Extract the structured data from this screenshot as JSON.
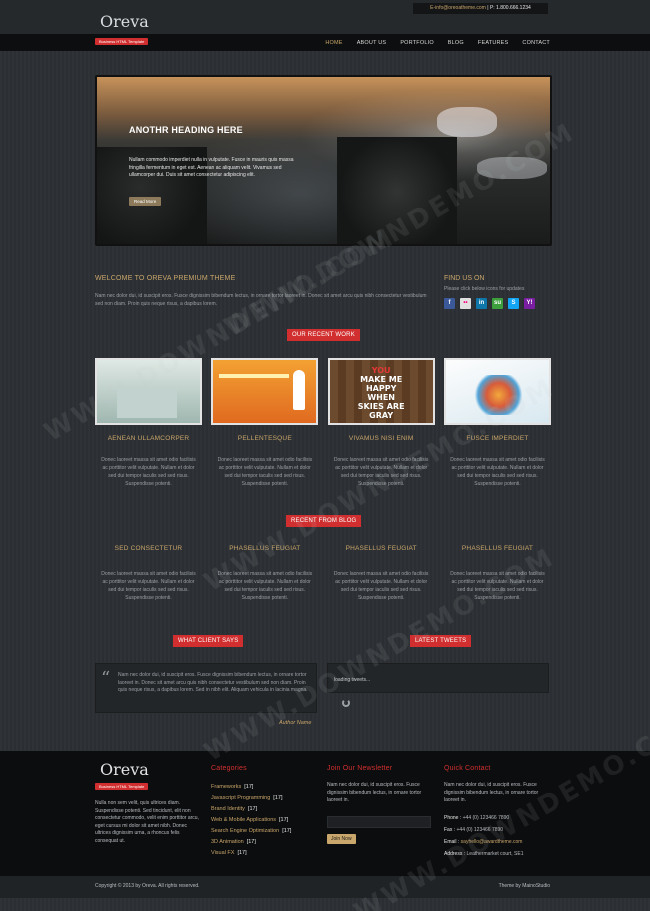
{
  "header": {
    "email": "E-info@oreoatheme.com",
    "phone_label": "P: 1.800.666.1234",
    "logo": "Oreva",
    "tag": "Business HTML Template"
  },
  "nav": {
    "items": [
      {
        "label": "HOME",
        "active": true
      },
      {
        "label": "ABOUT US",
        "active": false
      },
      {
        "label": "PORTFOLIO",
        "active": false
      },
      {
        "label": "BLOG",
        "active": false
      },
      {
        "label": "FEATURES",
        "active": false
      },
      {
        "label": "CONTACT",
        "active": false
      }
    ]
  },
  "slider": {
    "heading": "ANOTHR HEADING HERE",
    "text": "Nullam commodo imperdiet nulla in vulputate. Fusce in mauris quis massa fringilla fermentum in eget est. Aenean ac aliquam velit. Vivamus sed ullamcorper dui. Duis sit amet consectetur adipiscing elit.",
    "button": "Read More"
  },
  "welcome": {
    "title": "WELCOME TO OREVA PREMIUM THEME",
    "text": "Nam nec dolor dui, id suscipit eros. Fusce dignissim bibendum lectus, in ornare tortor laoreet in. Donec sit amet arcu quis nibh consectetur vestibulum sed non diam. Proin quis neque risus, a dapibus lorem."
  },
  "find_us": {
    "title": "FIND US ON",
    "subtitle": "Please click below icons for updates",
    "icons": [
      "facebook-icon",
      "flickr-icon",
      "linkedin-icon",
      "stumbleupon-icon",
      "skype-icon",
      "yahoo-icon"
    ]
  },
  "recent_work": {
    "label": "OUR RECENT WORK",
    "items": [
      {
        "title": "AENEAN ULLAMCORPER",
        "text": "Donec laoreet massa sit amet odio facilisis ac porttitor velit vulputate. Nullam et dolor sed dui tempor iaculis sed sed risus. Suspendisse potenti."
      },
      {
        "title": "PELLENTESQUE",
        "text": "Donec laoreet massa sit amet odio facilisis ac porttitor velit vulputate. Nullam et dolor sed dui tempor iaculis sed sed risus. Suspendisse potenti."
      },
      {
        "title": "VIVAMUS NISI ENIM",
        "text": "Donec laoreet massa sit amet odio facilisis ac porttitor velit vulputate. Nullam et dolor sed dui tempor iaculis sed sed risus. Suspendisse potenti."
      },
      {
        "title": "FUSCE IMPERDIET",
        "text": "Donec laoreet massa sit amet odio facilisis ac porttitor velit vulputate. Nullam et dolor sed dui tempor iaculis sed sed risus. Suspendisse potenti."
      }
    ],
    "thumb3_lines": [
      "YOU",
      "MAKE ME",
      "HAPPY",
      "WHEN",
      "SKIES ARE",
      "GRAY"
    ]
  },
  "recent_blog": {
    "label": "RECENT FROM BLOG",
    "items": [
      {
        "title": "SED CONSECTETUR",
        "text": "Donec laoreet massa sit amet odio facilisis ac porttitor velit vulputate. Nullam et dolor sed dui tempor iaculis sed sed risus. Suspendisse potenti."
      },
      {
        "title": "PHASELLUS FEUGIAT",
        "text": "Donec laoreet massa sit amet odio facilisis ac porttitor velit vulputate. Nullam et dolor sed dui tempor iaculis sed sed risus. Suspendisse potenti."
      },
      {
        "title": "PHASELLUS FEUGIAT",
        "text": "Donec laoreet massa sit amet odio facilisis ac porttitor velit vulputate. Nullam et dolor sed dui tempor iaculis sed sed risus. Suspendisse potenti."
      },
      {
        "title": "PHASELLUS FEUGIAT",
        "text": "Donec laoreet massa sit amet odio facilisis ac porttitor velit vulputate. Nullam et dolor sed dui tempor iaculis sed sed risus. Suspendisse potenti."
      }
    ]
  },
  "client": {
    "label": "WHAT CLIENT SAYS",
    "quote": "Nam nec dolor dui, id suscipit eros. Fusce dignissim bibendum lectus, in ornare tortor laoreet in. Donec sit amet arcu quis nibh consectetur vestibulum sed non diam. Proin quis neque risus, a dapibus lorem. Sed in nibh elit. Aliquam vehicula in lacinia magna.",
    "author": "Author Name"
  },
  "tweets": {
    "label": "LATEST TWEETS",
    "loading": "loading tweets..."
  },
  "footer": {
    "logo": "Oreva",
    "tag": "Business HTML Template",
    "about": "Nulla non sem velit, quis ultrices diam. Suspendisse potenti. Sed tincidunt, elit non consectetur commodo, velit enim porttitor arcu, eget cursus mi dolor sit amet nibh. Donec ultrices dignissim urna, a rhoncus felis consequat ut.",
    "categories_title": "Categories",
    "categories": [
      {
        "name": "Frameworks",
        "count": "[17]"
      },
      {
        "name": "Javascript Programming",
        "count": "[17]"
      },
      {
        "name": "Brand Identity",
        "count": "[17]"
      },
      {
        "name": "Web & Mobile Applications",
        "count": "[17]"
      },
      {
        "name": "Search Engine Optimization",
        "count": "[17]"
      },
      {
        "name": "3D Animation",
        "count": "[17]"
      },
      {
        "name": "Visual FX",
        "count": "[17]"
      }
    ],
    "newsletter_title": "Join Our Newsletter",
    "newsletter_text": "Nam nec dolor dui, id suscipit eros. Fusce dignissim bibendum lectus, in ornare tortor laoreet in.",
    "newsletter_button": "Join Now",
    "quick_title": "Quick Contact",
    "quick_text": "Nam nec dolor dui, id suscipit eros. Fusce dignissim bibendum lectus, in ornare tortor laoreet in.",
    "phone_label": "Phone :",
    "phone": "+44 (0) 123466 7890",
    "fax_label": "Fax :",
    "fax": "+44 (0) 123466 7890",
    "email_label": "Email :",
    "email": "sayhello@awardtheme.com",
    "address_label": "Address :",
    "address": "Leathermarket court, SE1"
  },
  "bottom": {
    "copyright": "Copyright © 2013 by Oreva. All rights reserved.",
    "credit": "Theme by MainoStudio"
  },
  "watermark": "WWW.DOWNDEMO.COM",
  "colors": {
    "accent_red": "#d12f2f",
    "accent_gold": "#c9a66b",
    "background": "#2d3034",
    "footer": "#0c0d0e"
  }
}
